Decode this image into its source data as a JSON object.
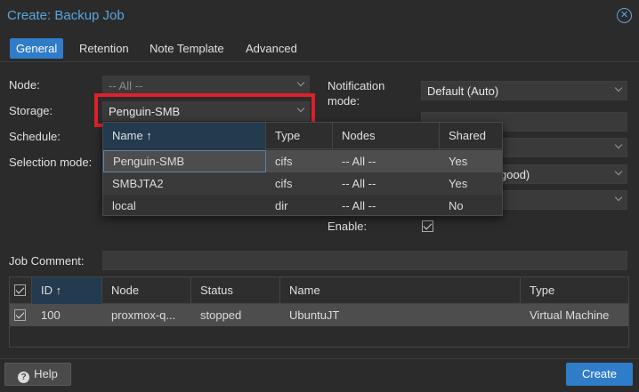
{
  "window": {
    "title": "Create: Backup Job"
  },
  "tabs": [
    "General",
    "Retention",
    "Note Template",
    "Advanced"
  ],
  "form": {
    "node_label": "Node:",
    "node_value": "-- All --",
    "storage_label": "Storage:",
    "storage_value": "Penguin-SMB",
    "schedule_label": "Schedule:",
    "selection_mode_label": "Selection mode:",
    "notification_mode_label": "Notification mode:",
    "notification_mode_value": "Default (Auto)",
    "compression_value_partial": "good)",
    "enable_label": "Enable:",
    "job_comment_label": "Job Comment:"
  },
  "storage_dropdown": {
    "columns": [
      "Name ↑",
      "Type",
      "Nodes",
      "Shared"
    ],
    "rows": [
      {
        "name": "Penguin-SMB",
        "type": "cifs",
        "nodes": "-- All --",
        "shared": "Yes"
      },
      {
        "name": "SMBJTA2",
        "type": "cifs",
        "nodes": "-- All --",
        "shared": "Yes"
      },
      {
        "name": "local",
        "type": "dir",
        "nodes": "-- All --",
        "shared": "No"
      }
    ]
  },
  "guest_table": {
    "columns": [
      "ID ↑",
      "Node",
      "Status",
      "Name",
      "Type"
    ],
    "rows": [
      {
        "id": "100",
        "node": "proxmox-q...",
        "status": "stopped",
        "name": "UbuntuJT",
        "type": "Virtual Machine"
      }
    ]
  },
  "buttons": {
    "help": "Help",
    "create": "Create"
  },
  "colors": {
    "accent": "#2f7cc9",
    "title": "#5aa6e0",
    "highlight": "#e0202a"
  }
}
